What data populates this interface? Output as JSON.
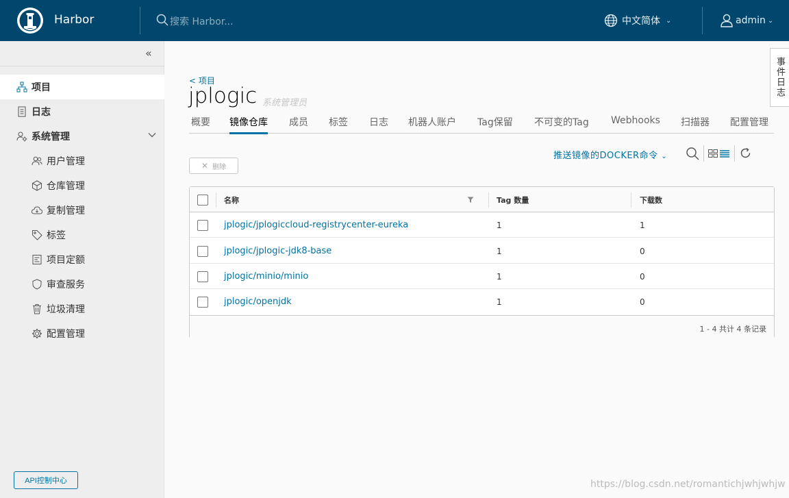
{
  "header": {
    "brand": "Harbor",
    "search_placeholder": "搜索 Harbor...",
    "language": "中文简体",
    "user": "admin"
  },
  "sidebar": {
    "items": [
      {
        "label": "项目",
        "icon": "projects-icon",
        "level": "top",
        "active": true
      },
      {
        "label": "日志",
        "icon": "logs-icon",
        "level": "top",
        "active": false
      },
      {
        "label": "系统管理",
        "icon": "admin-icon",
        "level": "top",
        "active": false,
        "expanded": true
      },
      {
        "label": "用户管理",
        "icon": "users-icon",
        "level": "sub"
      },
      {
        "label": "仓库管理",
        "icon": "registry-icon",
        "level": "sub"
      },
      {
        "label": "复制管理",
        "icon": "cloud-icon",
        "level": "sub"
      },
      {
        "label": "标签",
        "icon": "tag-icon",
        "level": "sub"
      },
      {
        "label": "项目定额",
        "icon": "quota-icon",
        "level": "sub"
      },
      {
        "label": "审查服务",
        "icon": "shield-icon",
        "level": "sub"
      },
      {
        "label": "垃圾清理",
        "icon": "trash-icon",
        "level": "sub"
      },
      {
        "label": "配置管理",
        "icon": "gear-icon",
        "level": "sub"
      }
    ],
    "api_button": "API控制中心"
  },
  "page": {
    "back_link": "< 项目",
    "title": "jplogic",
    "role": "系统管理员"
  },
  "tabs": [
    {
      "label": "概要"
    },
    {
      "label": "镜像仓库",
      "active": true
    },
    {
      "label": "成员"
    },
    {
      "label": "标签"
    },
    {
      "label": "日志"
    },
    {
      "label": "机器人账户"
    },
    {
      "label": "Tag保留"
    },
    {
      "label": "不可变的Tag"
    },
    {
      "label": "Webhooks"
    },
    {
      "label": "扫描器"
    },
    {
      "label": "配置管理"
    }
  ],
  "toolbar": {
    "push_command": "推送镜像的DOCKER命令",
    "delete_label": "删除"
  },
  "table": {
    "columns": [
      "名称",
      "Tag 数量",
      "下载数"
    ],
    "rows": [
      {
        "name": "jplogic/jplogiccloud-registrycenter-eureka",
        "tags": "1",
        "pulls": "1"
      },
      {
        "name": "jplogic/jplogic-jdk8-base",
        "tags": "1",
        "pulls": "0"
      },
      {
        "name": "jplogic/minio/minio",
        "tags": "1",
        "pulls": "0"
      },
      {
        "name": "jplogic/openjdk",
        "tags": "1",
        "pulls": "0"
      }
    ],
    "footer": "1 - 4 共计 4 条记录"
  },
  "event_log": "事件日志",
  "watermark": "https://blog.csdn.net/romantichjwhjwhjw",
  "colors": {
    "header_bg": "#00466d",
    "accent": "#0072a3"
  }
}
